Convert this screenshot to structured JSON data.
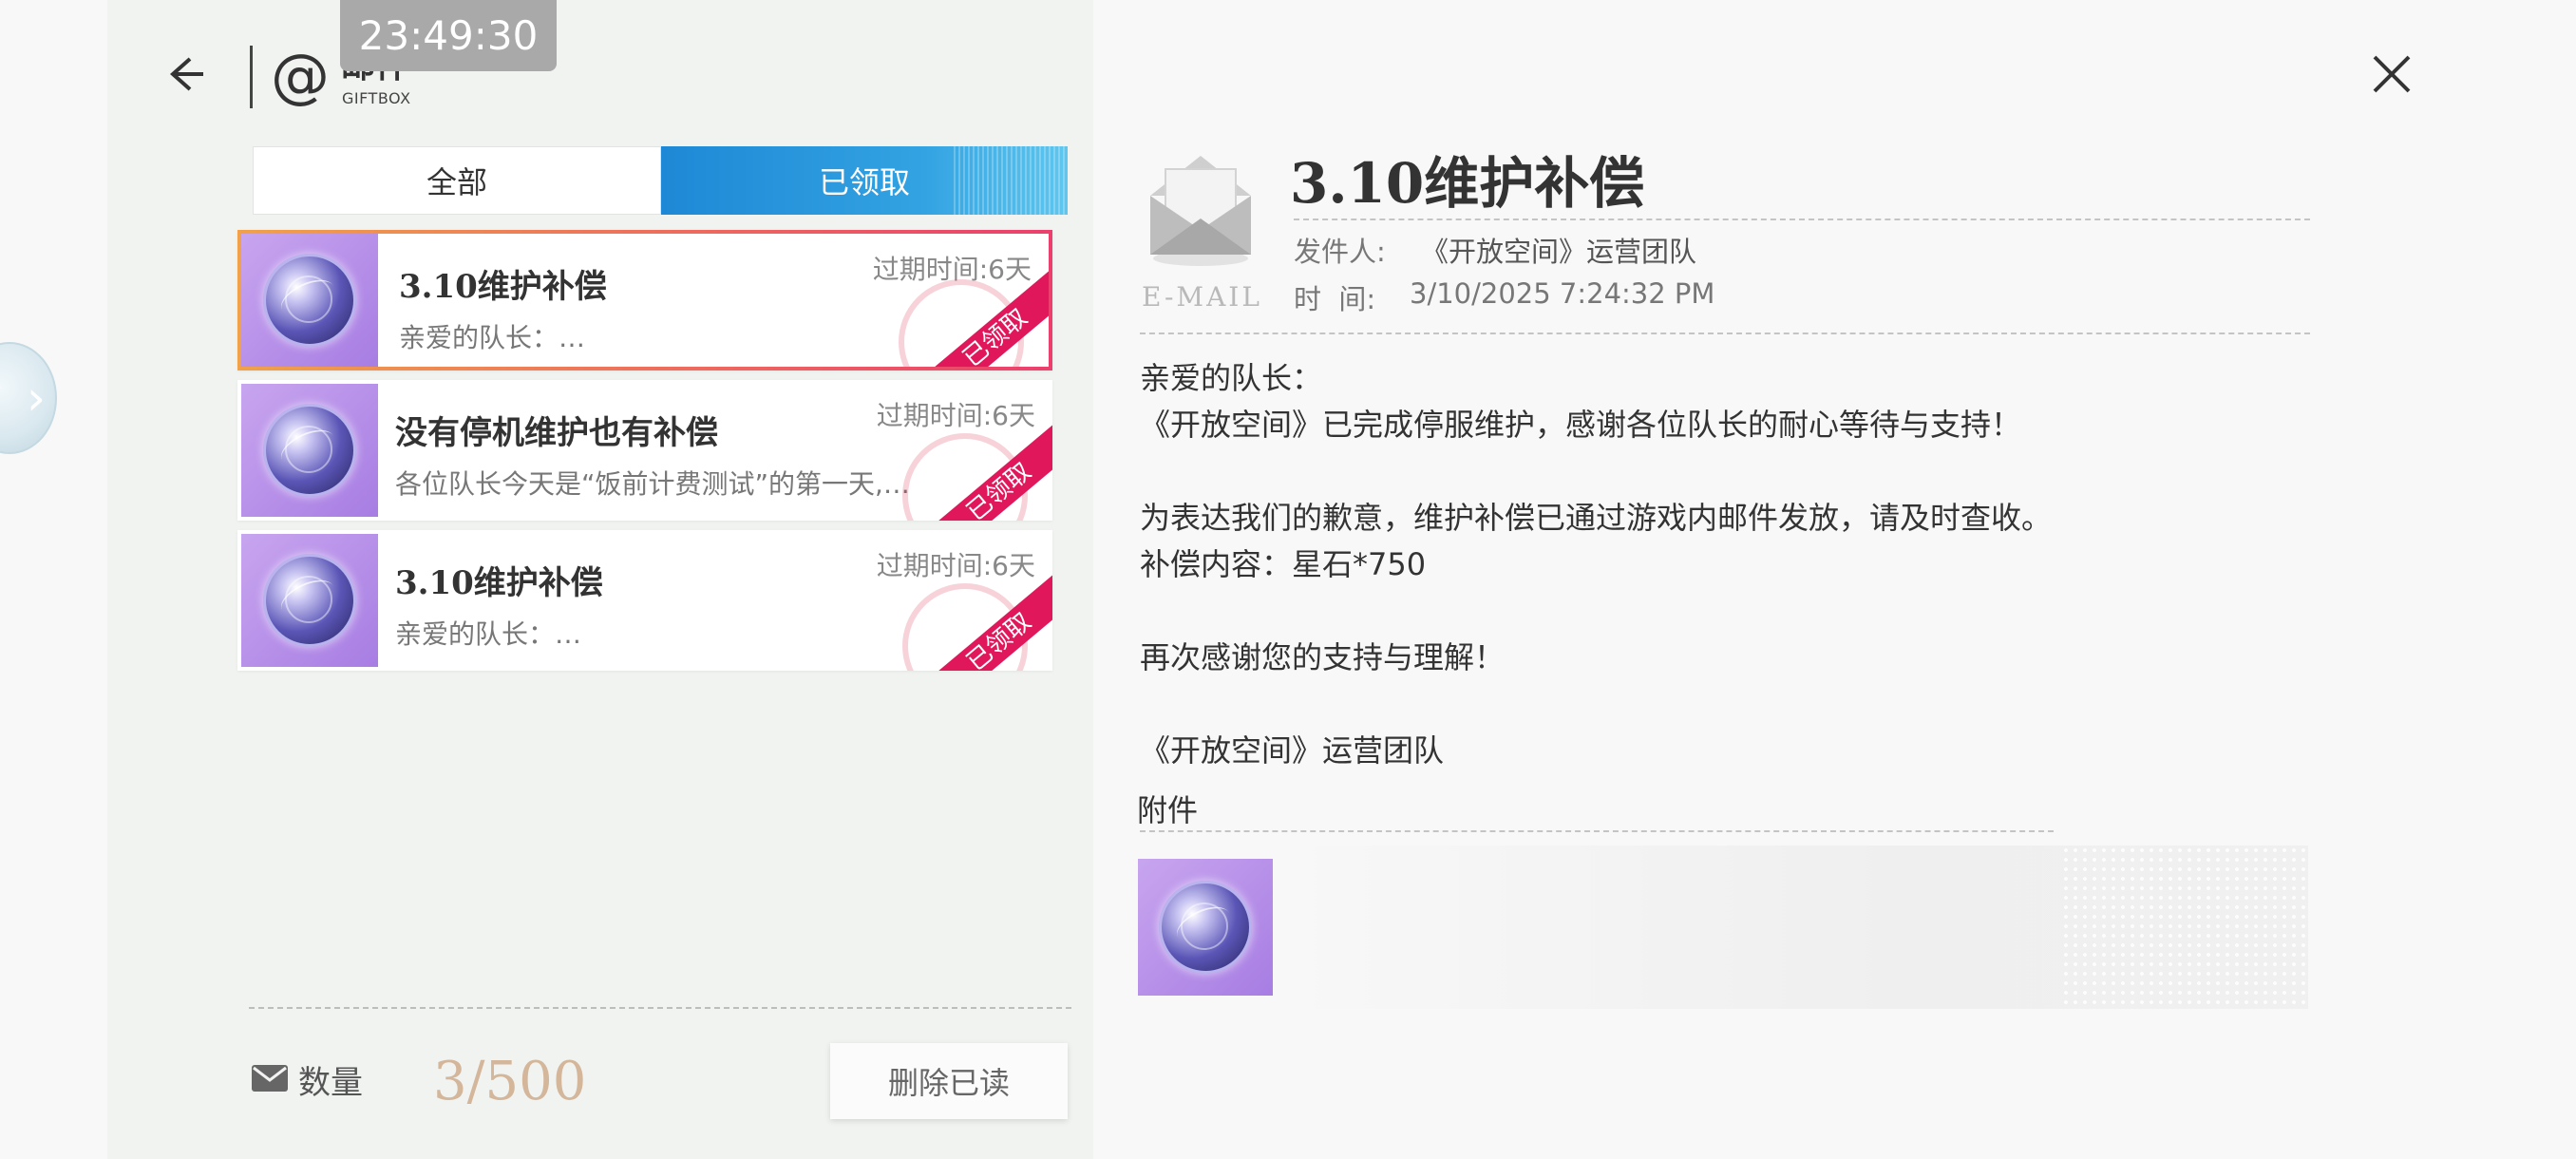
{
  "status_bar": {
    "time": "23:49:30"
  },
  "header": {
    "title": "邮件",
    "subtitle": "GIFTBOX"
  },
  "tabs": [
    {
      "label": "全部",
      "active": false
    },
    {
      "label": "已领取",
      "active": true
    }
  ],
  "mail_list": [
    {
      "title": "3.10维护补偿",
      "preview": "亲爱的队长：…",
      "expire": "过期时间:6天",
      "stamp": "已领取",
      "selected": true
    },
    {
      "title": "没有停机维护也有补偿",
      "preview": "各位队长今天是“饭前计费测试”的第一天,…",
      "expire": "过期时间:6天",
      "stamp": "已领取",
      "selected": false
    },
    {
      "title": "3.10维护补偿",
      "preview": "亲爱的队长：…",
      "expire": "过期时间:6天",
      "stamp": "已领取",
      "selected": false
    }
  ],
  "footer": {
    "count_label": "数量",
    "count_value": "3/500",
    "delete_read_label": "删除已读"
  },
  "detail": {
    "icon_label": "E-MAIL",
    "title": "3.10维护补偿",
    "sender_label": "发件人:",
    "sender_value": "《开放空间》运营团队",
    "time_label": "时  间:",
    "time_value": "3/10/2025 7:24:32 PM",
    "body_lines": [
      "亲爱的队长：",
      "《开放空间》已完成停服维护，感谢各位队长的耐心等待与支持！",
      "",
      "为表达我们的歉意，维护补偿已通过游戏内邮件发放，请及时查收。",
      "补偿内容：星石*750",
      "",
      "再次感谢您的支持与理解！",
      "",
      "《开放空间》运营团队"
    ],
    "attachments_label": "附件"
  },
  "colors": {
    "tab_active": "#1e88d6",
    "stamp": "#e0185b",
    "count_value": "#d4b69b",
    "item_purple": "#b38ce8"
  },
  "icons": [
    "back-arrow-icon",
    "at-icon",
    "close-icon",
    "envelope-icon",
    "crystal-orb-icon",
    "mail-count-icon"
  ]
}
